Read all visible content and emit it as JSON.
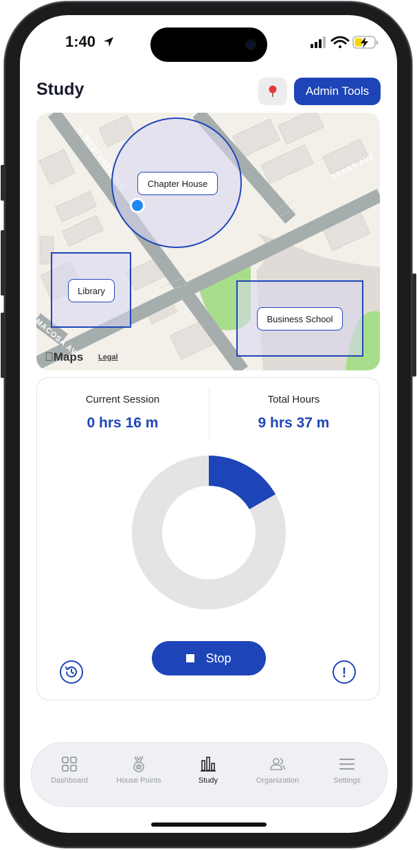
{
  "status_bar": {
    "time": "1:40"
  },
  "header": {
    "title": "Study",
    "admin_button": "Admin Tools"
  },
  "map": {
    "street_labels": [
      "S WESTGATE AVE",
      "TEXAS AVE",
      "MACOSA AVE"
    ],
    "zones": [
      {
        "label": "Chapter House",
        "shape": "circle"
      },
      {
        "label": "Library",
        "shape": "rectangle"
      },
      {
        "label": "Business School",
        "shape": "rectangle"
      }
    ],
    "attribution": "Maps",
    "legal": "Legal"
  },
  "session": {
    "current_label": "Current Session",
    "current_value": "0 hrs 16 m",
    "total_label": "Total Hours",
    "total_value": "9 hrs 37 m",
    "progress_fraction": 0.167
  },
  "actions": {
    "stop_label": "Stop"
  },
  "tabs": [
    {
      "label": "Dashboard",
      "icon": "grid-icon",
      "active": false
    },
    {
      "label": "House Points",
      "icon": "medal-icon",
      "active": false
    },
    {
      "label": "Study",
      "icon": "bar-chart-icon",
      "active": true
    },
    {
      "label": "Organization",
      "icon": "people-icon",
      "active": false
    },
    {
      "label": "Settings",
      "icon": "menu-icon",
      "active": false
    }
  ],
  "colors": {
    "accent": "#1d45b8",
    "track": "#e4e4e6",
    "title": "#1a1c2e"
  }
}
